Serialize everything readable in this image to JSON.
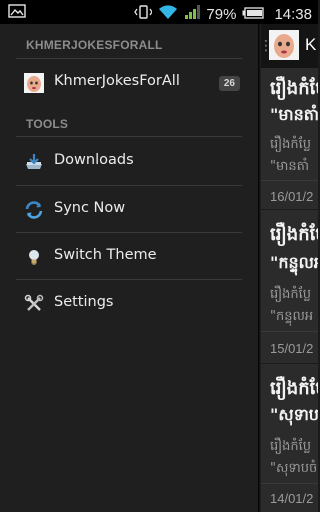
{
  "status": {
    "battery_pct": "79%",
    "time": "14:38"
  },
  "drawer": {
    "section1": "KHMERJOKESFORALL",
    "feed": {
      "label": "KhmerJokesForAll",
      "count": "26"
    },
    "section2": "TOOLS",
    "items": [
      {
        "label": "Downloads",
        "icon": "download-icon"
      },
      {
        "label": "Sync Now",
        "icon": "sync-icon"
      },
      {
        "label": "Switch Theme",
        "icon": "lightbulb-icon"
      },
      {
        "label": "Settings",
        "icon": "settings-icon"
      }
    ]
  },
  "content": {
    "title": "K",
    "cards": [
      {
        "t1": "រឿងកំប៉ែ",
        "t2": "\"មានតាំ",
        "s1": "រឿងកំប្លែ",
        "s2": "\"មានតាំ",
        "date": "16/01/2"
      },
      {
        "t1": "រឿងកំប៉ែ",
        "t2": "\"កន្ទុលអ",
        "s1": "រឿងកំប្លែ",
        "s2": "\"កន្ទុលអ",
        "date": "15/01/2"
      },
      {
        "t1": "រឿងកំប៉ែ",
        "t2": "\"សុទាប",
        "s1": "រឿងកំប្លែ",
        "s2": "\"សុទាបចំ",
        "date": "14/01/2"
      }
    ]
  },
  "colors": {
    "drawer_bg": "#1f1f1f",
    "content_bg": "#2b2b2b",
    "status_bg": "#000000",
    "signal_green": "#7fc241",
    "wifi_blue": "#33b5e5"
  }
}
